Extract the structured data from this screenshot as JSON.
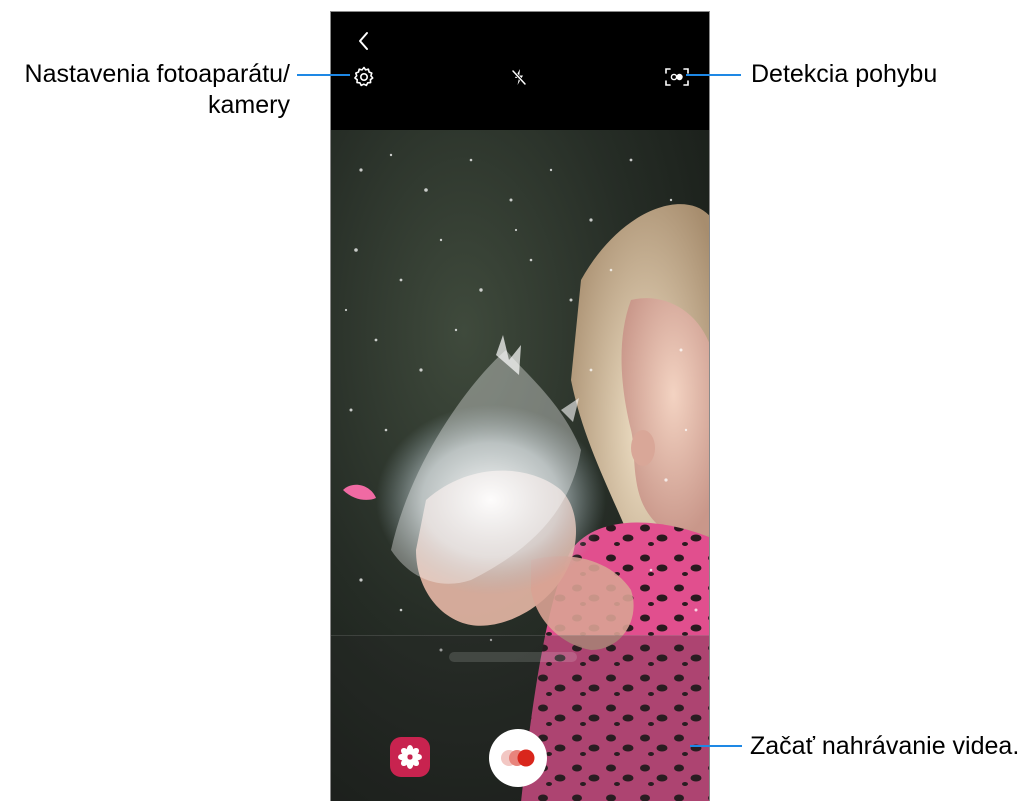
{
  "callouts": {
    "settings": {
      "line1": "Nastavenia fotoaparátu/",
      "line2": "kamery"
    },
    "motion_detection": "Detekcia pohybu",
    "start_recording": "Začať nahrávanie videa."
  },
  "topbar": {
    "back_icon": "chevron-left-icon",
    "settings_icon": "gear-icon",
    "flash_icon": "flash-off-icon",
    "motion_icon": "motion-detect-icon"
  },
  "bottom": {
    "gallery_icon": "flower-icon",
    "record_icon": "record-dots-icon"
  },
  "colors": {
    "accent_line": "#1e88e5",
    "gallery_bg": "#c8234f",
    "record_dot": "#d9261c"
  }
}
